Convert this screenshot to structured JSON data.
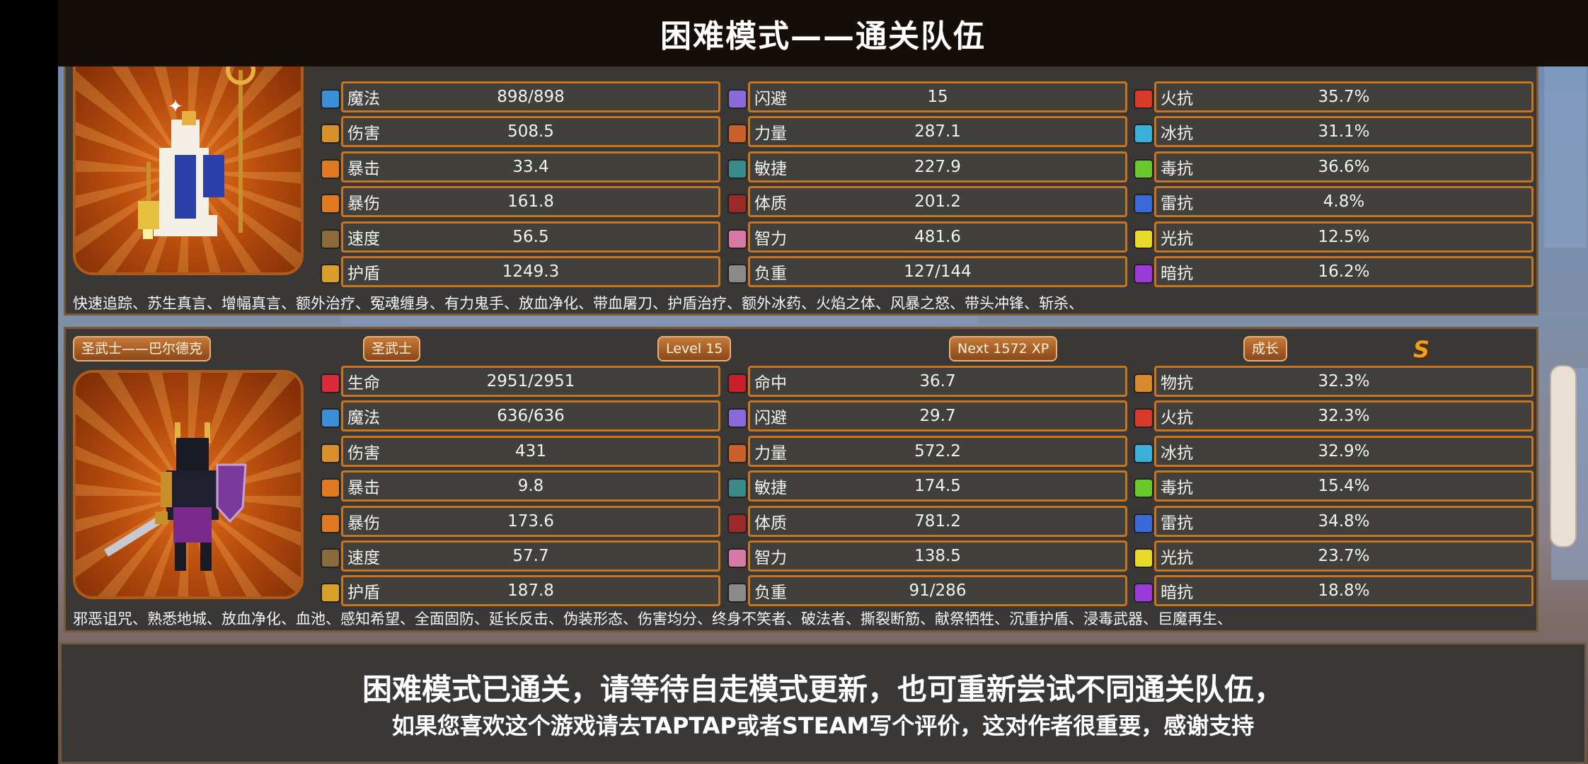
{
  "title": "困难模式——通关队伍",
  "hero1": {
    "col1": [
      {
        "label": "魔法",
        "value": "898/898",
        "icon": "mana-icon",
        "color": "#3a8fd8"
      },
      {
        "label": "伤害",
        "value": "508.5",
        "icon": "damage-icon",
        "color": "#d8902a"
      },
      {
        "label": "暴击",
        "value": "33.4",
        "icon": "crit-icon",
        "color": "#e07a22"
      },
      {
        "label": "暴伤",
        "value": "161.8",
        "icon": "crit-damage-icon",
        "color": "#e07a22"
      },
      {
        "label": "速度",
        "value": "56.5",
        "icon": "speed-icon",
        "color": "#8a6a3a"
      },
      {
        "label": "护盾",
        "value": "1249.3",
        "icon": "shield-icon",
        "color": "#d8a02a"
      }
    ],
    "col2": [
      {
        "label": "闪避",
        "value": "15",
        "icon": "dodge-icon",
        "color": "#8a6ad8"
      },
      {
        "label": "力量",
        "value": "287.1",
        "icon": "strength-icon",
        "color": "#c8602a"
      },
      {
        "label": "敏捷",
        "value": "227.9",
        "icon": "agility-icon",
        "color": "#3a8a8a"
      },
      {
        "label": "体质",
        "value": "201.2",
        "icon": "constitution-icon",
        "color": "#9a2a2a"
      },
      {
        "label": "智力",
        "value": "481.6",
        "icon": "intelligence-icon",
        "color": "#d87aa8"
      },
      {
        "label": "负重",
        "value": "127/144",
        "icon": "weight-icon",
        "color": "#8a8a8a"
      }
    ],
    "col3": [
      {
        "label": "火抗",
        "value": "35.7%",
        "icon": "fire-resist-icon",
        "color": "#d83a2a"
      },
      {
        "label": "冰抗",
        "value": "31.1%",
        "icon": "ice-resist-icon",
        "color": "#3ab0d8"
      },
      {
        "label": "毒抗",
        "value": "36.6%",
        "icon": "poison-resist-icon",
        "color": "#6ac82a"
      },
      {
        "label": "雷抗",
        "value": "4.8%",
        "icon": "thunder-resist-icon",
        "color": "#3a6ad8"
      },
      {
        "label": "光抗",
        "value": "12.5%",
        "icon": "light-resist-icon",
        "color": "#e8d82a"
      },
      {
        "label": "暗抗",
        "value": "16.2%",
        "icon": "dark-resist-icon",
        "color": "#9a3ad8"
      }
    ],
    "skills": "快速追踪、苏生真言、增幅真言、额外治疗、冤魂缠身、有力鬼手、放血净化、带血屠刀、护盾治疗、额外冰药、火焰之体、风暴之怒、带头冲锋、斩杀、"
  },
  "hero2": {
    "name_tag": "圣武士——巴尔德克",
    "class_tag": "圣武士",
    "level_tag": "Level 15",
    "xp_tag": "Next 1572 XP",
    "growth_tag": "成长",
    "grade": "S",
    "col1": [
      {
        "label": "生命",
        "value": "2951/2951",
        "icon": "health-icon",
        "color": "#d82a3a"
      },
      {
        "label": "魔法",
        "value": "636/636",
        "icon": "mana-icon",
        "color": "#3a8fd8"
      },
      {
        "label": "伤害",
        "value": "431",
        "icon": "damage-icon",
        "color": "#d8902a"
      },
      {
        "label": "暴击",
        "value": "9.8",
        "icon": "crit-icon",
        "color": "#e07a22"
      },
      {
        "label": "暴伤",
        "value": "173.6",
        "icon": "crit-damage-icon",
        "color": "#e07a22"
      },
      {
        "label": "速度",
        "value": "57.7",
        "icon": "speed-icon",
        "color": "#8a6a3a"
      },
      {
        "label": "护盾",
        "value": "187.8",
        "icon": "shield-icon",
        "color": "#d8a02a"
      }
    ],
    "col2": [
      {
        "label": "命中",
        "value": "36.7",
        "icon": "accuracy-icon",
        "color": "#c8202a"
      },
      {
        "label": "闪避",
        "value": "29.7",
        "icon": "dodge-icon",
        "color": "#8a6ad8"
      },
      {
        "label": "力量",
        "value": "572.2",
        "icon": "strength-icon",
        "color": "#c8602a"
      },
      {
        "label": "敏捷",
        "value": "174.5",
        "icon": "agility-icon",
        "color": "#3a8a8a"
      },
      {
        "label": "体质",
        "value": "781.2",
        "icon": "constitution-icon",
        "color": "#9a2a2a"
      },
      {
        "label": "智力",
        "value": "138.5",
        "icon": "intelligence-icon",
        "color": "#d87aa8"
      },
      {
        "label": "负重",
        "value": "91/286",
        "icon": "weight-icon",
        "color": "#8a8a8a"
      }
    ],
    "col3": [
      {
        "label": "物抗",
        "value": "32.3%",
        "icon": "physical-resist-icon",
        "color": "#d88a2a"
      },
      {
        "label": "火抗",
        "value": "32.3%",
        "icon": "fire-resist-icon",
        "color": "#d83a2a"
      },
      {
        "label": "冰抗",
        "value": "32.9%",
        "icon": "ice-resist-icon",
        "color": "#3ab0d8"
      },
      {
        "label": "毒抗",
        "value": "15.4%",
        "icon": "poison-resist-icon",
        "color": "#6ac82a"
      },
      {
        "label": "雷抗",
        "value": "34.8%",
        "icon": "thunder-resist-icon",
        "color": "#3a6ad8"
      },
      {
        "label": "光抗",
        "value": "23.7%",
        "icon": "light-resist-icon",
        "color": "#e8d82a"
      },
      {
        "label": "暗抗",
        "value": "18.8%",
        "icon": "dark-resist-icon",
        "color": "#9a3ad8"
      }
    ],
    "skills": "邪恶诅咒、熟悉地城、放血净化、血池、感知希望、全面固防、延长反击、伪装形态、伤害均分、终身不笑者、破法者、撕裂断筋、献祭牺牲、沉重护盾、浸毒武器、巨魔再生、"
  },
  "footer": {
    "line1": "困难模式已通关，请等待自走模式更新，也可重新尝试不同通关队伍，",
    "line2": "如果您喜欢这个游戏请去TAPTAP或者STEAM写个评价，这对作者很重要，感谢支持"
  }
}
